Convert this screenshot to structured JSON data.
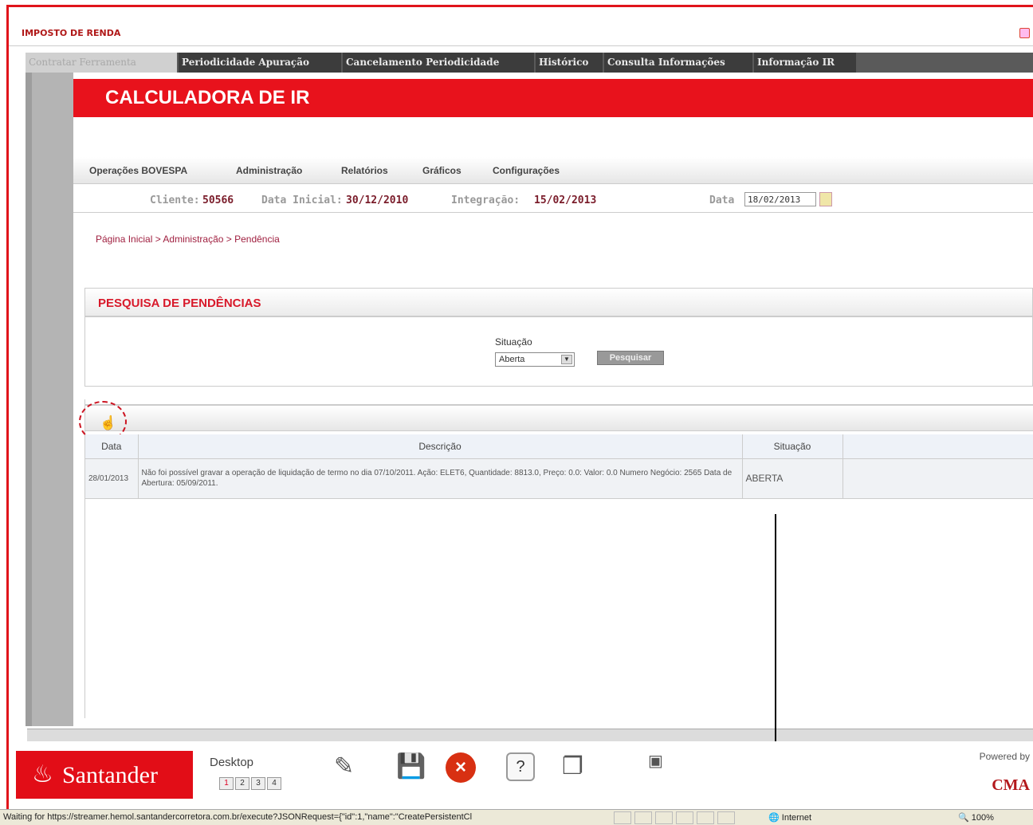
{
  "window": {
    "title": "IMPOSTO DE RENDA"
  },
  "tabs": [
    "Contratar Ferramenta",
    "Periodicidade Apuração",
    "Cancelamento Periodicidade",
    "Histórico",
    "Consulta Informações",
    "Informação IR"
  ],
  "header": {
    "title": "CALCULADORA DE IR"
  },
  "menu": [
    "Operações BOVESPA",
    "Administração",
    "Relatórios",
    "Gráficos",
    "Configurações"
  ],
  "info": {
    "cliente_label": "Cliente:",
    "cliente": "50566",
    "data_inicial_label": "Data Inicial:",
    "data_inicial": "30/12/2010",
    "integracao_label": "Integração:",
    "integracao": "15/02/2013",
    "data_label": "Data",
    "data": "18/02/2013"
  },
  "breadcrumb": "Página Inicial > Administração > Pendência",
  "search": {
    "title": "PESQUISA DE PENDÊNCIAS",
    "situacao_label": "Situação",
    "situacao_value": "Aberta",
    "button": "Pesquisar"
  },
  "table": {
    "columns": [
      "Data",
      "Descrição",
      "Situação"
    ],
    "rows": [
      {
        "data": "28/01/2013",
        "descricao": "Não foi possível gravar a operação de liquidação de termo no dia 07/10/2011. Ação: ELET6, Quantidade: 8813.0, Preço: 0.0: Valor: 0.0 Numero Negócio: 2565 Data de Abertura: 05/09/2011.",
        "situacao": "ABERTA"
      }
    ]
  },
  "taskbar": {
    "brand": "Santander",
    "desktop_label": "Desktop",
    "desktops": [
      "1",
      "2",
      "3",
      "4"
    ],
    "powered_by": "Powered by",
    "vendor": "CMA"
  },
  "statusbar": {
    "message": "Waiting for https://streamer.hemol.santandercorretora.com.br/execute?JSONRequest={\"id\":1,\"name\":\"CreatePersistentCl",
    "zone": "Internet",
    "zoom": "100%"
  },
  "colors": {
    "brand_red": "#e8121c",
    "accent_dark_red": "#7a1c2a"
  }
}
